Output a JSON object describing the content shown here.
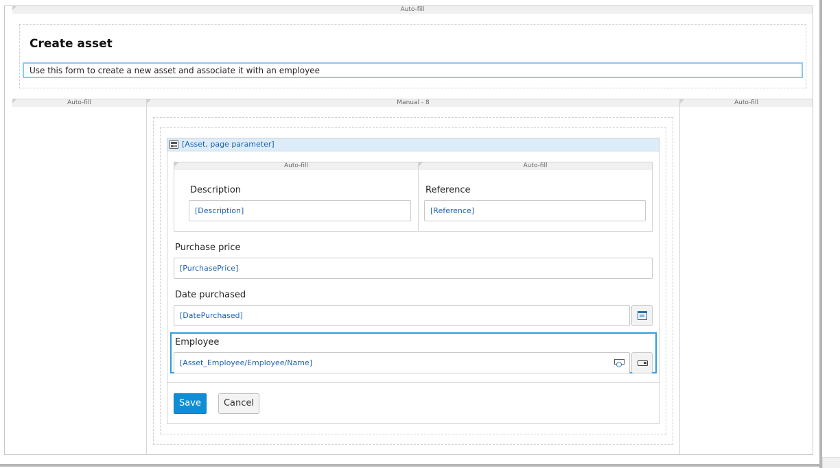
{
  "top_container": {
    "header": "Auto-fill",
    "title": "Create asset",
    "intro_text": "Use this form to create a new asset and associate it with an employee"
  },
  "layout_columns": [
    {
      "header": "Auto-fill"
    },
    {
      "header": "Manual - 8"
    },
    {
      "header": "Auto-fill"
    }
  ],
  "dataview": {
    "title": "[Asset, page parameter]",
    "inner_columns": [
      {
        "header": "Auto-fill",
        "label": "Description",
        "value": "[Description]"
      },
      {
        "header": "Auto-fill",
        "label": "Reference",
        "value": "[Reference]"
      }
    ],
    "purchase_price": {
      "label": "Purchase price",
      "value": "[PurchasePrice]"
    },
    "date_purchased": {
      "label": "Date purchased",
      "value": "[DatePurchased]"
    },
    "employee": {
      "label": "Employee",
      "value": "[Asset_Employee/Employee/Name]"
    },
    "save_label": "Save",
    "cancel_label": "Cancel"
  },
  "icons": [
    "dataview-icon",
    "calendar-icon",
    "reference-selector-icon",
    "select-button-icon"
  ],
  "colors": {
    "accent": "#0f8ed6",
    "selection": "#2d9be0",
    "dataview_header": "#dcecf8",
    "link_text": "#1d61b0"
  }
}
